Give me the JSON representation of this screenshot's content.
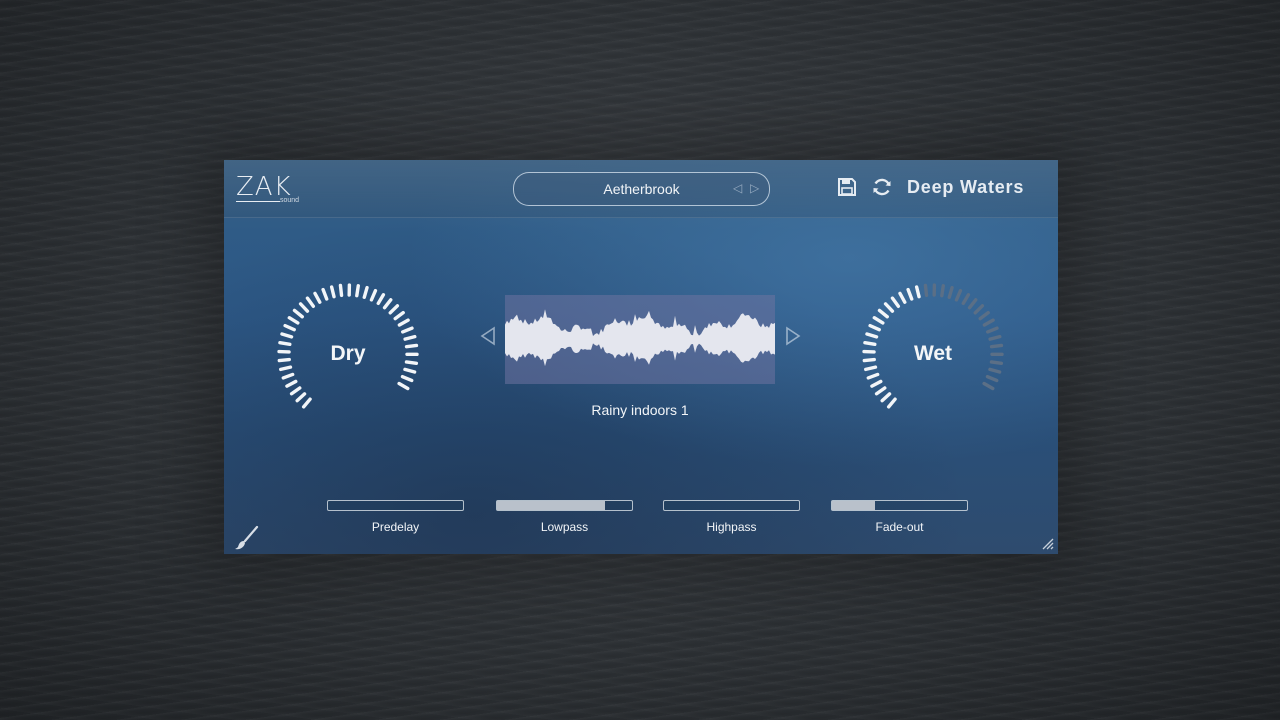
{
  "header": {
    "logo_text": "ZAK",
    "logo_subtext": "sound",
    "preset_name": "Aetherbrook",
    "product_name": "Deep Waters",
    "icons": {
      "save": "save-icon",
      "refresh": "refresh-icon",
      "prev_preset": "prev-preset-icon",
      "next_preset": "next-preset-icon"
    }
  },
  "knobs": {
    "dry": {
      "label": "Dry",
      "level": 1.0
    },
    "wet": {
      "label": "Wet",
      "level": 0.5
    }
  },
  "sample": {
    "name": "Rainy indoors 1",
    "prev_icon": "triangle-left-icon",
    "next_icon": "triangle-right-icon"
  },
  "sliders": [
    {
      "label": "Predelay",
      "value": 0.0
    },
    {
      "label": "Lowpass",
      "value": 0.8
    },
    {
      "label": "Highpass",
      "value": 0.0
    },
    {
      "label": "Fade-out",
      "value": 0.32
    }
  ],
  "footer": {
    "brush_icon": "paintbrush-icon",
    "resize_icon": "resize-grip-icon"
  },
  "colors": {
    "panel_blue": "#2d5886",
    "accent_white": "#f2f5f8",
    "tick_inactive": "#5b6f86",
    "waveform": "#e4e6ee",
    "slider_fill": "#b9c1cb"
  }
}
